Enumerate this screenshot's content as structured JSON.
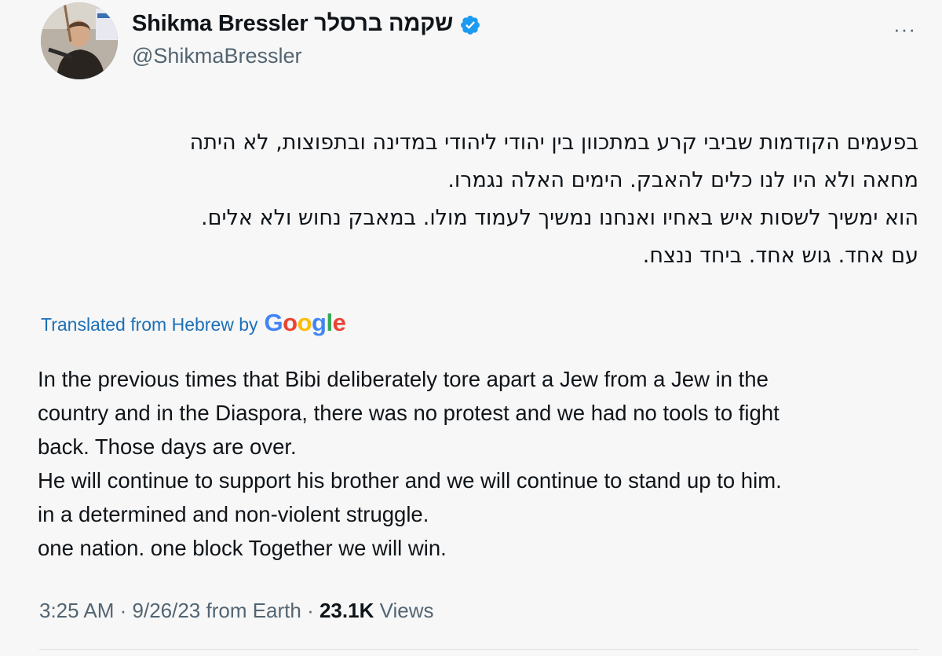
{
  "author": {
    "display_name": "Shikma Bressler",
    "display_name_hebrew": "שקמה ברסלר",
    "handle": "@ShikmaBressler",
    "verified": true
  },
  "icons": {
    "verified": "verified-badge-icon",
    "more": "more-options-icon",
    "more_glyph": "···"
  },
  "tweet": {
    "hebrew_lines": [
      "בפעמים הקודמות שביבי קרע במתכוון בין יהודי ליהודי במדינה ובתפוצות, לא היתה",
      "מחאה ולא היו לנו כלים להאבק. הימים האלה נגמרו.",
      "הוא ימשיך לשסות איש באחיו ואנחנו נמשיך לעמוד מולו. במאבק נחוש ולא אלים.",
      "עם אחד. גוש אחד. ביחד ננצח."
    ],
    "translation_label": "Translated from Hebrew by",
    "translation_provider": "Google",
    "english_lines": [
      "In the previous times that Bibi deliberately tore apart a Jew from a Jew in the",
      "country and in the Diaspora, there was no protest and we had no tools to fight",
      "back. Those days are over.",
      "He will continue to support his brother and we will continue to stand up to him.",
      "in a determined and non-violent struggle.",
      "one nation. one block Together we will win."
    ]
  },
  "meta": {
    "time": "3:25 AM",
    "separator": " · ",
    "date": "9/26/23",
    "source": " from Earth",
    "views_count": "23.1K",
    "views_label": " Views"
  },
  "colors": {
    "background": "#f7f7f7",
    "text": "#0f1419",
    "secondary": "#536471",
    "link": "#1d6fb8",
    "verified": "#1d9bf0",
    "google_blue": "#4285F4",
    "google_red": "#EA4335",
    "google_yellow": "#FBBC05",
    "google_green": "#34A853"
  }
}
